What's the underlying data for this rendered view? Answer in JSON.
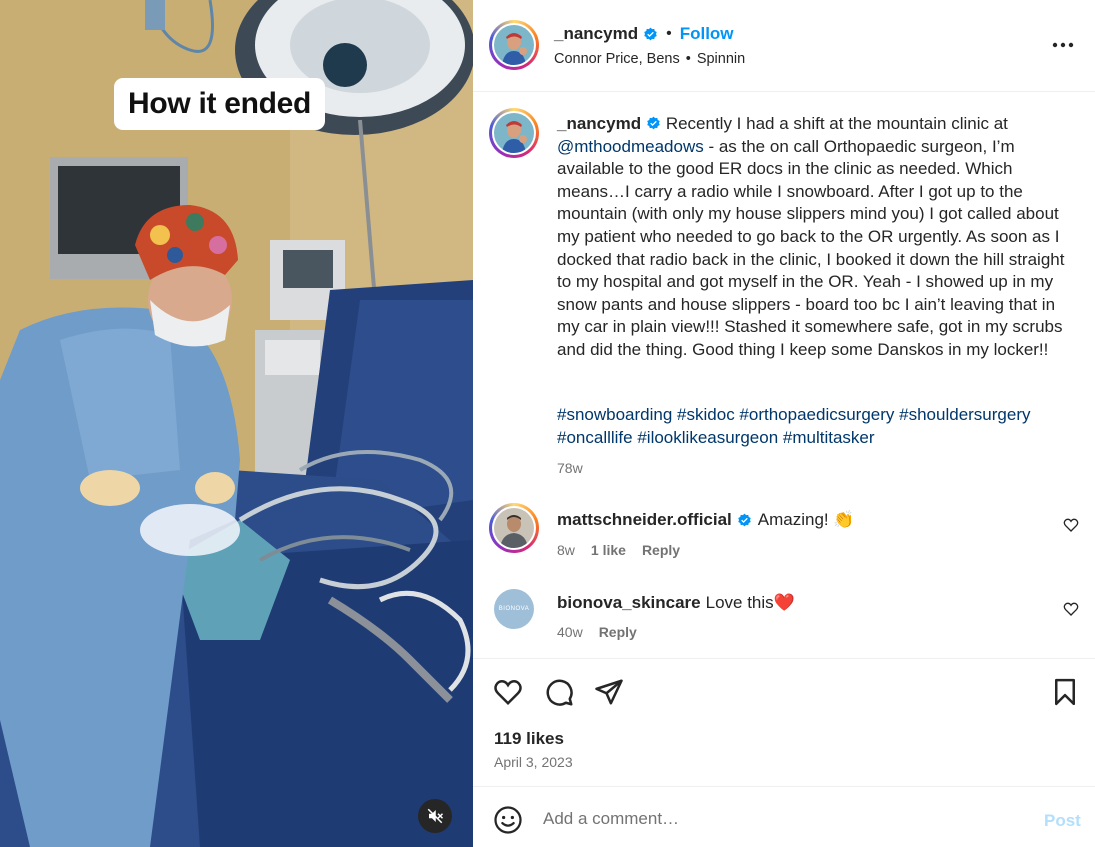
{
  "media": {
    "overlay_caption": "How it ended",
    "mute_icon": "speaker-muted-icon"
  },
  "header": {
    "username": "_nancymd",
    "separator": "•",
    "follow_label": "Follow",
    "music_artist": "Connor Price, Bens",
    "music_separator": "•",
    "music_track": "Spinnin",
    "more_icon": "more-options-icon"
  },
  "caption": {
    "username": "_nancymd",
    "text_before_mention": " Recently I had a shift at the mountain clinic at ",
    "mention": "@mthoodmeadows",
    "text_after_mention": " - as the on call Orthopaedic surgeon, I’m available to the good ER docs in the clinic as needed. Which means…I carry a radio while I snowboard. After I got up to the mountain (with only my house slippers mind you) I got called about my patient who needed to go back to the OR urgently. As soon as I docked that radio back in the clinic, I booked it down the hill straight to my hospital and got myself in the OR. Yeah - I showed up in my snow pants and house slippers - board too bc I ain’t leaving that in my car in plain view!!! Stashed it somewhere safe, got in my scrubs and did the thing. Good thing I keep some Danskos in my locker!!",
    "hashtags": [
      "#snowboarding",
      "#skidoc",
      "#orthopaedicsurgery",
      "#shouldersurgery",
      "#oncalllife",
      "#ilooklikeasurgeon",
      "#multitasker"
    ],
    "time_ago": "78w"
  },
  "comments": [
    {
      "username": "mattschneider.official",
      "text": "Amazing! 👏",
      "time": "8w",
      "likes": "1 like",
      "reply_label": "Reply"
    },
    {
      "username": "bionova_skincare",
      "avatar_text": "BIONOVA",
      "text": "Love this❤️",
      "time": "40w",
      "reply_label": "Reply"
    }
  ],
  "actions": {
    "like_icon": "heart-icon",
    "comment_icon": "comment-bubble-icon",
    "share_icon": "paper-plane-icon",
    "save_icon": "bookmark-icon",
    "likes_count": "119 likes",
    "date": "April 3, 2023"
  },
  "comment_box": {
    "placeholder": "Add a comment…",
    "post_label": "Post",
    "emoji_icon": "smiley-icon"
  },
  "colors": {
    "accent": "#0095f6",
    "link": "#00376b",
    "muted": "#737373",
    "post_disabled": "#b2dffc"
  }
}
